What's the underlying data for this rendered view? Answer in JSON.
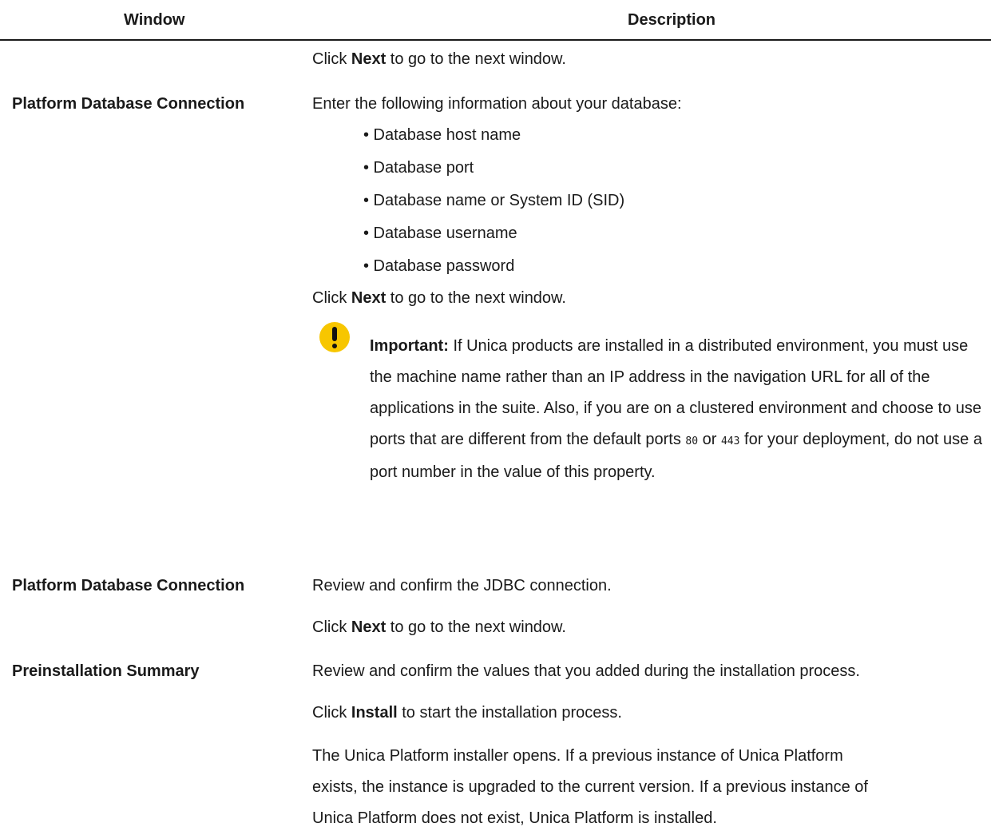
{
  "table": {
    "header_window": "Window",
    "header_description": "Description"
  },
  "rows": {
    "r0_next": {
      "pre": "Click ",
      "bold": "Next",
      "post": " to go to the next window."
    },
    "r1_window": "Platform Database Connection",
    "r1_intro": "Enter the following information about your database:",
    "r1_bullets": [
      "• Database host name",
      "• Database port",
      "• Database name or System ID (SID)",
      "• Database username",
      "• Database password"
    ],
    "r1_next": {
      "pre": "Click ",
      "bold": "Next",
      "post": " to go to the next window."
    },
    "r1_note": {
      "label": "Important:",
      "text_a": " If Unica products are installed in a distributed environment, you must use the machine name rather than an IP address in the navigation URL for all of the applications in the suite. Also, if you are on a clustered environment and choose to use ports that are different from the default ports ",
      "port1": "80",
      "or": " or ",
      "port2": "443",
      "text_b": " for your deployment, do not use a port number in the value of this property."
    },
    "r2_window": "Platform Database Connection",
    "r2_desc": "Review and confirm the JDBC connection.",
    "r2_next": {
      "pre": "Click ",
      "bold": "Next",
      "post": " to go to the next window."
    },
    "r3_window": "Preinstallation Summary",
    "r3_desc": "Review and confirm the values that you added during the installation process.",
    "r3_install": {
      "pre": "Click ",
      "bold": "Install",
      "post": " to start the installation process."
    },
    "r3_lines": [
      "The Unica Platform installer opens. If a previous instance of Unica Platform",
      "exists, the instance is upgraded to the current version. If a previous instance of",
      "Unica Platform does not exist, Unica Platform is installed."
    ]
  }
}
